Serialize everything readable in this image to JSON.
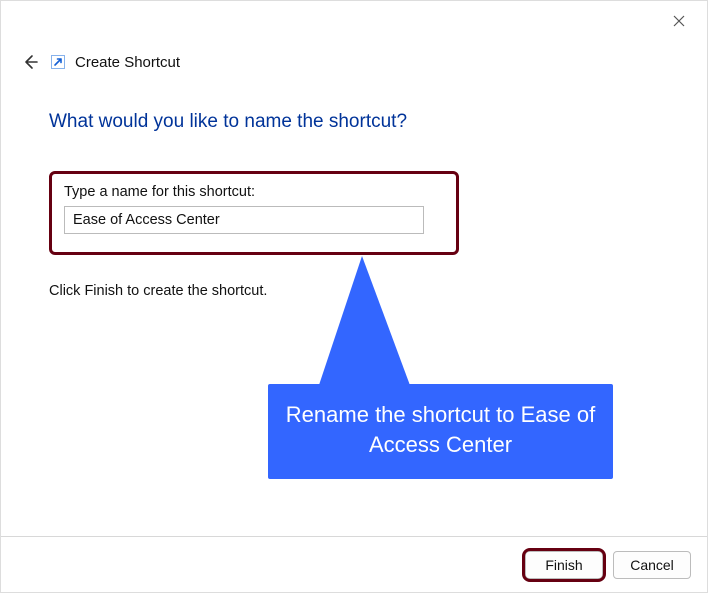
{
  "window": {
    "title": "Create Shortcut"
  },
  "content": {
    "prompt": "What would you like to name the shortcut?",
    "input_label": "Type a name for this shortcut:",
    "input_value": "Ease of Access Center",
    "hint": "Click Finish to create the shortcut."
  },
  "callout": {
    "text": "Rename the shortcut to Ease of Access Center",
    "color": "#3366ff"
  },
  "footer": {
    "finish": "Finish",
    "cancel": "Cancel"
  },
  "highlight_color": "#660011"
}
